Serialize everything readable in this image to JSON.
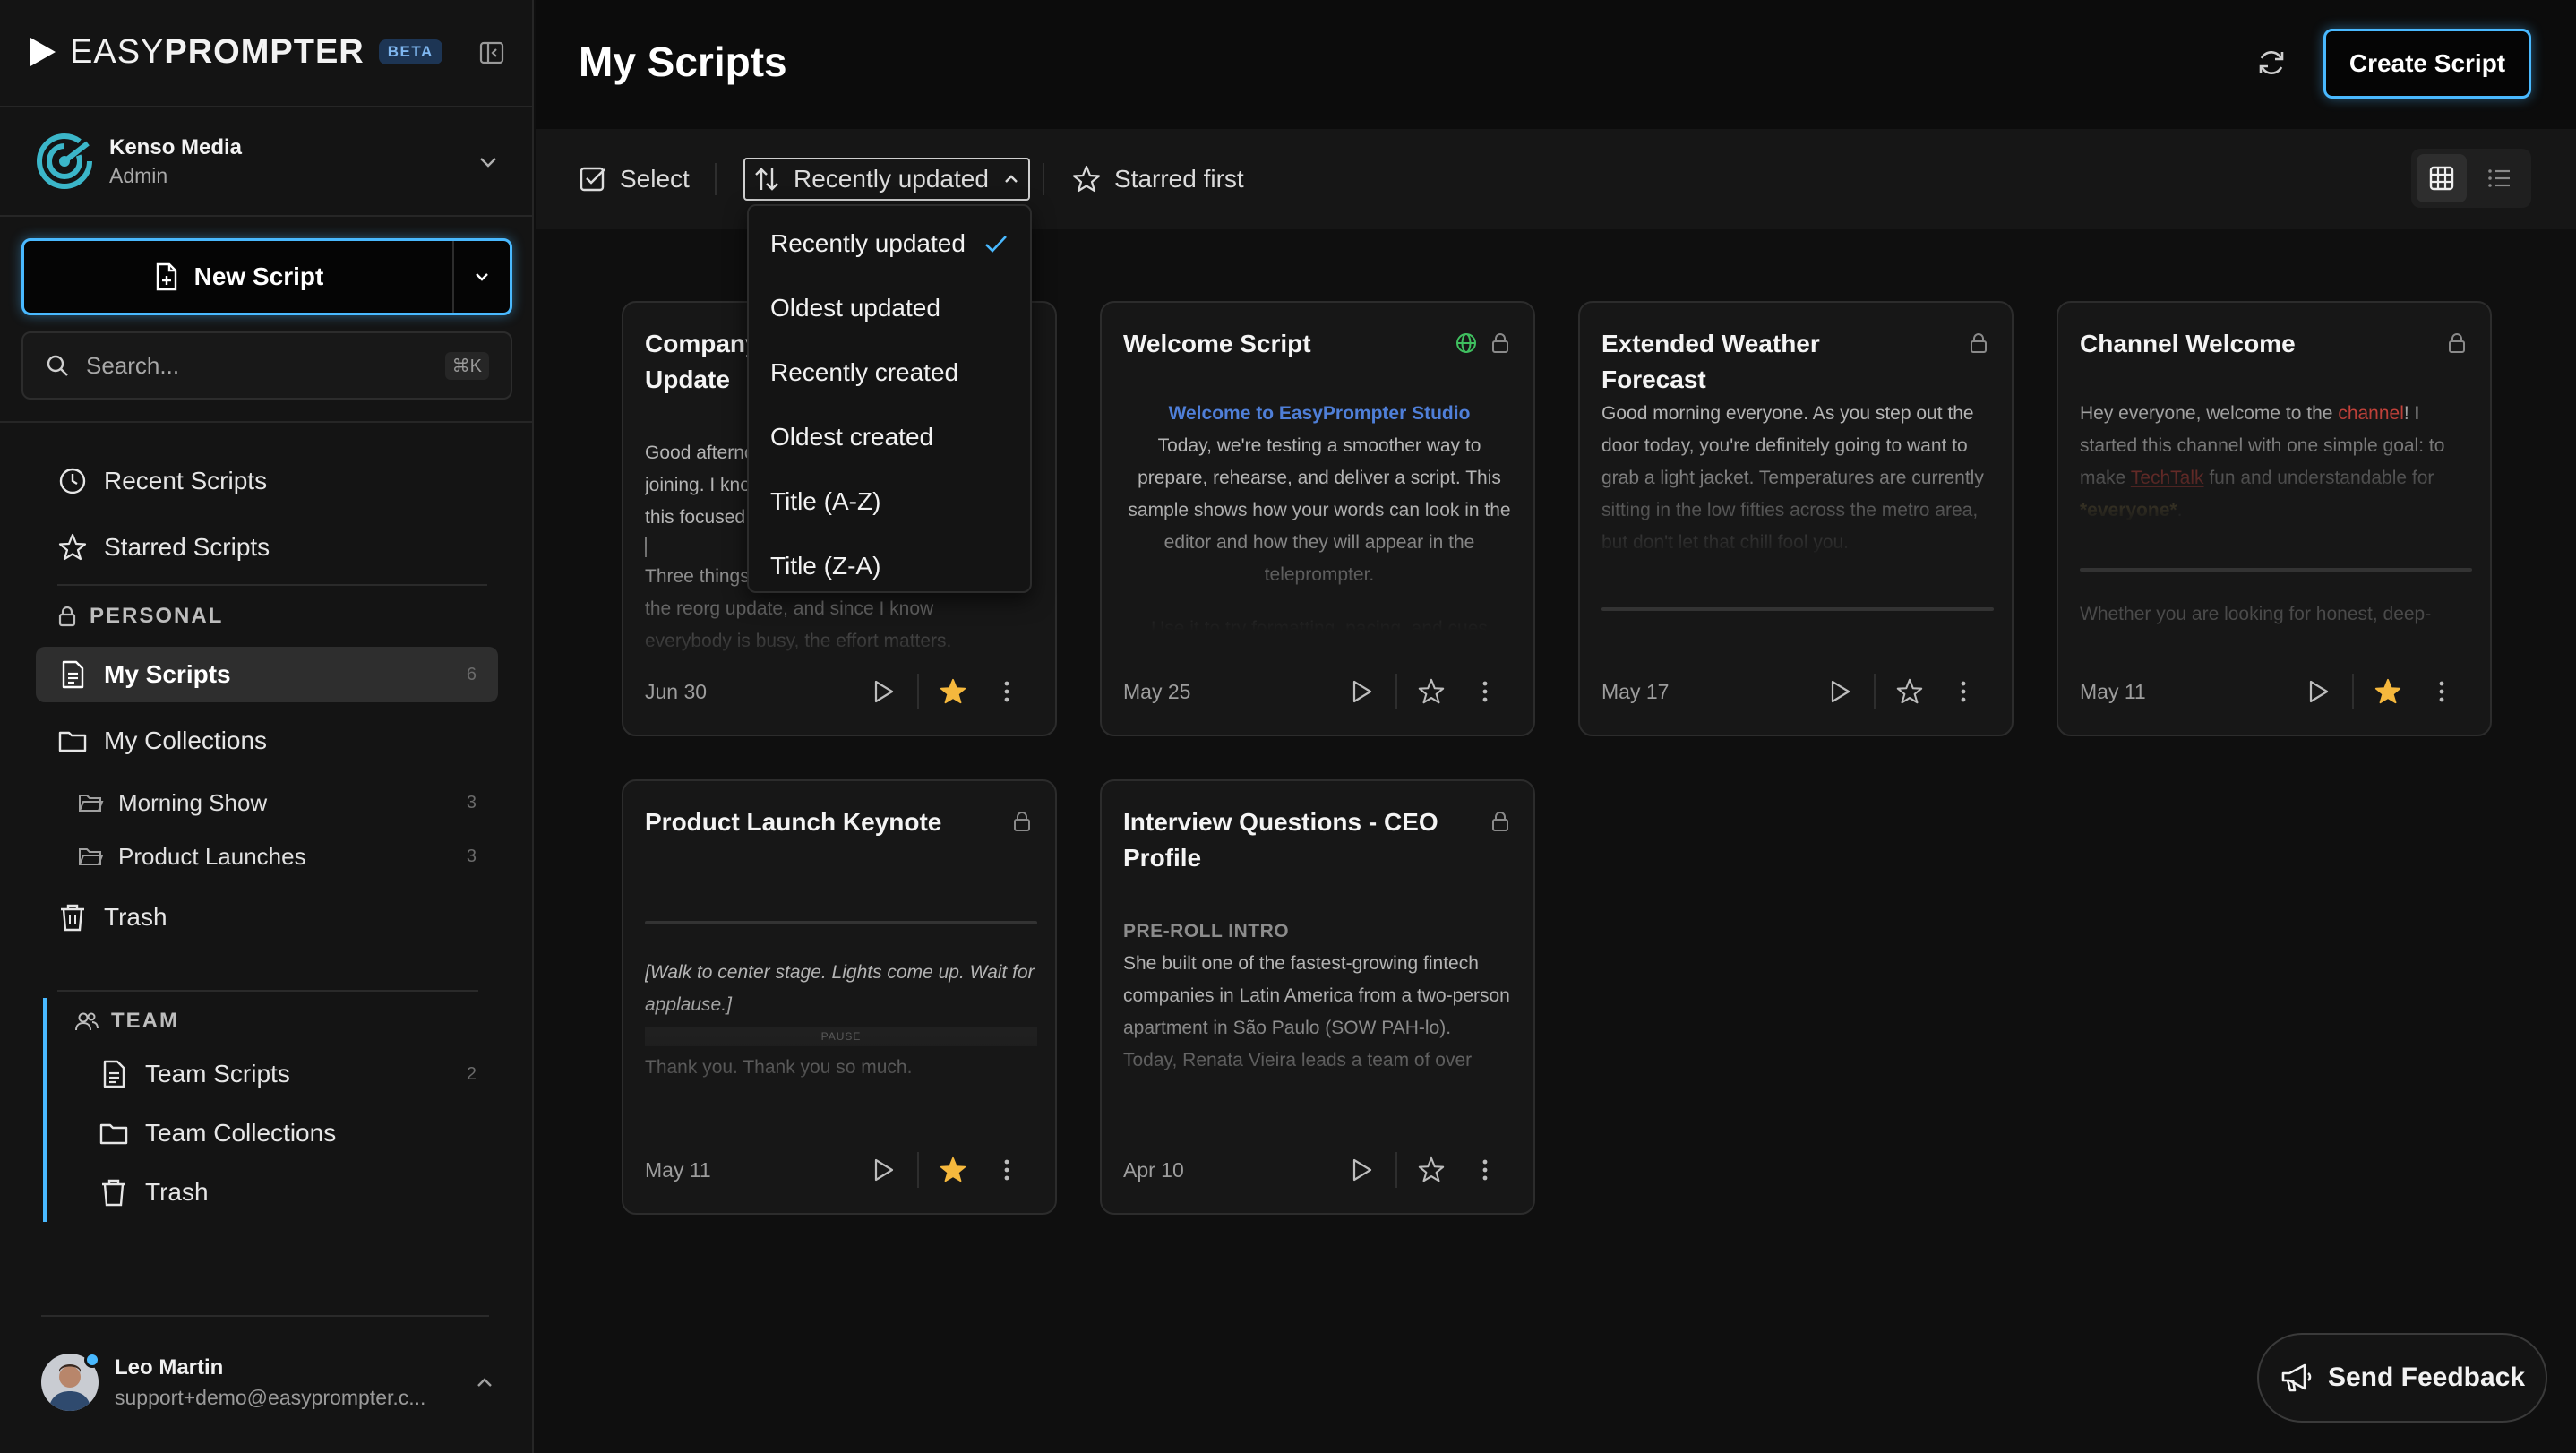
{
  "brand": {
    "name_thin": "EASY",
    "name_bold": "PROMPTER",
    "badge": "BETA"
  },
  "org": {
    "name": "Kenso Media",
    "role": "Admin"
  },
  "new_script": {
    "label": "New Script"
  },
  "search": {
    "placeholder": "Search...",
    "shortcut": "⌘K"
  },
  "nav": {
    "recent": "Recent Scripts",
    "starred": "Starred Scripts",
    "personal_label": "PERSONAL",
    "my_scripts": "My Scripts",
    "my_scripts_count": "6",
    "my_collections": "My Collections",
    "collections": [
      {
        "label": "Morning Show",
        "count": "3"
      },
      {
        "label": "Product Launches",
        "count": "3"
      }
    ],
    "trash": "Trash",
    "team_label": "TEAM",
    "team_scripts": "Team Scripts",
    "team_scripts_count": "2",
    "team_collections": "Team Collections",
    "team_trash": "Trash"
  },
  "user": {
    "name": "Leo Martin",
    "email": "support+demo@easyprompter.c..."
  },
  "header": {
    "title": "My Scripts",
    "create_label": "Create Script"
  },
  "toolbar": {
    "select": "Select",
    "sort": "Recently updated",
    "starred_first": "Starred first",
    "view": "grid"
  },
  "sort_options": [
    "Recently updated",
    "Oldest updated",
    "Recently created",
    "Oldest created",
    "Title (A-Z)",
    "Title (Z-A)"
  ],
  "sort_selected": "Recently updated",
  "cards": [
    {
      "title": "Company Update",
      "date": "Jun 30",
      "starred": true,
      "lines": [
        "Good afternoon everyone, and thank you for",
        "joining. I know it has been a busy week, so",
        "this focused update will be short.",
        "Three things to cover today. First,",
        "the reorg update, and since I know",
        "everybody is busy, the effort matters."
      ]
    },
    {
      "title": "Welcome Script",
      "date": "May 25",
      "starred": false,
      "heading": "Welcome to EasyPrompter Studio",
      "body": "Today, we're testing a smoother way to prepare, rehearse, and deliver a script. This sample shows how your words can look in the editor and how they will appear in the teleprompter.",
      "faded": "Use it to try formatting, pacing, and cues"
    },
    {
      "title": "Extended Weather Forecast",
      "date": "May 17",
      "starred": false,
      "body": "Good morning everyone. As you step out the door today, you're definitely going to want to grab a light jacket. Temperatures are currently sitting in the low fifties across the metro area, but don't let that chill fool you."
    },
    {
      "title": "Channel Welcome",
      "date": "May 11",
      "starred": true,
      "body_a": "Hey everyone, welcome to the ",
      "body_red": "channel",
      "body_b": "! I started this channel with one simple goal: to make ",
      "body_link": "TechTalk",
      "body_c": " fun and understandable for ",
      "body_gold": "*everyone*",
      "body_d": ".",
      "faded": "Whether you are looking for honest, deep-"
    },
    {
      "title": "Product Launch Keynote",
      "date": "May 11",
      "starred": true,
      "cue": "[Walk to center stage. Lights come up. Wait for applause.]",
      "pause": "PAUSE",
      "body": "Thank you. Thank you so much."
    },
    {
      "title": "Interview Questions - CEO Profile",
      "date": "Apr 10",
      "starred": false,
      "tag": "PRE-ROLL INTRO",
      "body": "She built one of the fastest-growing fintech companies in Latin America from a two-person apartment in São Paulo (SOW PAH-lo).",
      "faded": "Today, Renata Vieira leads a team of over"
    }
  ],
  "feedback": {
    "label": "Send Feedback"
  },
  "colors": {
    "accent": "#49b9ff",
    "star": "#f5b83d",
    "globe": "#3fbf5f"
  }
}
